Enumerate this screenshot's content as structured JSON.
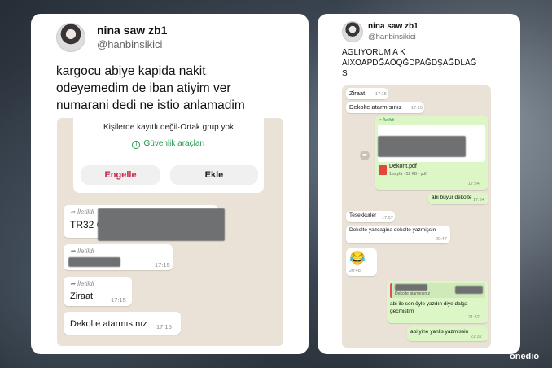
{
  "left_tweet": {
    "name": "nina saw zb1",
    "handle": "@hanbinsikici",
    "text_lines": [
      "kargocu abiye kapida nakit",
      "odeyemedim de iban atiyim ver",
      "numarani dedi ne istio anlamadim"
    ],
    "dialog": {
      "info": "Kişilerde kayıtlı değil·Ortak grup yok",
      "security": "Güvenlik araçları",
      "block_label": "Engelle",
      "add_label": "Ekle"
    },
    "messages": [
      {
        "forwarded": "İletildi",
        "text": "TR32 C",
        "suffix": "2",
        "time": ""
      },
      {
        "forwarded": "İletildi",
        "text": "",
        "time": "17:15"
      },
      {
        "forwarded": "İletildi",
        "text": "Ziraat",
        "time": "17:15"
      },
      {
        "forwarded": "",
        "text": "Dekolte atarmısınız",
        "time": "17:15"
      }
    ]
  },
  "right_tweet": {
    "name": "nina saw zb1",
    "handle": "@hanbinsikici",
    "text_lines": [
      "AGLIYORUM A   K",
      "AIXOAPDĞAÖQĞDPAĞDŞAĞDLAĞ",
      "S"
    ],
    "messages": {
      "m1": {
        "text": "Ziraat",
        "time": "17:15"
      },
      "m2": {
        "text": "Dekolte atarmısınız",
        "time": "17:15"
      },
      "forward": "İletildi",
      "file_name": "Dekont.pdf",
      "file_meta": "1 sayfa · 52 KB · pdf",
      "file_time": "17:34",
      "m3": {
        "text": "abi buyur dekolte",
        "time": "17:34"
      },
      "m4": {
        "text": "Tesekkurler",
        "time": "17:57"
      },
      "m5": {
        "text": "Dekolte yazcagina dekolte yazmişsin",
        "time": "20:47"
      },
      "emoji": "😂",
      "emoji_time": "20:48",
      "quote_text": "Dekolte atarmısınız",
      "m6": {
        "text": "abi ile sen öyle yazdın diye dalga gecmistim",
        "time": "21:32"
      },
      "m7": {
        "text": "abi yine yanlis yazmissin",
        "time": "21:32"
      }
    }
  },
  "watermark": "onedio"
}
